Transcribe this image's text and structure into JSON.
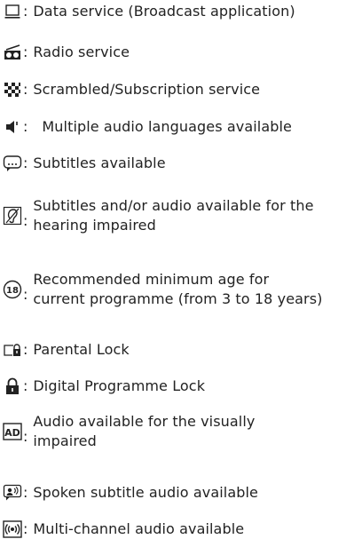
{
  "colon": ":",
  "items": [
    {
      "icon": "data-service-icon",
      "label": "Data service (Broadcast application)"
    },
    {
      "icon": "radio-service-icon",
      "label": "Radio service"
    },
    {
      "icon": "scrambled-service-icon",
      "label": "Scrambled/Subscription service"
    },
    {
      "icon": "multiple-audio-icon",
      "label": "Multiple audio languages available"
    },
    {
      "icon": "subtitles-icon",
      "label": "Subtitles available"
    },
    {
      "icon": "hearing-impaired-icon",
      "label": "Subtitles and/or audio available for the",
      "label_line2": "hearing impaired"
    },
    {
      "icon": "age-rating-icon",
      "icon_text": "18",
      "label": "Recommended minimum age for",
      "label_line2": "current programme (from 3 to 18 years)"
    },
    {
      "icon": "parental-lock-icon",
      "label": "Parental Lock"
    },
    {
      "icon": "padlock-icon",
      "label": "Digital Programme Lock"
    },
    {
      "icon": "audio-description-icon",
      "icon_text": "AD",
      "label": "Audio available for the visually",
      "label_line2": "impaired"
    },
    {
      "icon": "spoken-subtitle-icon",
      "label": "Spoken subtitle audio available"
    },
    {
      "icon": "multi-channel-audio-icon",
      "label": "Multi-channel audio available"
    }
  ]
}
